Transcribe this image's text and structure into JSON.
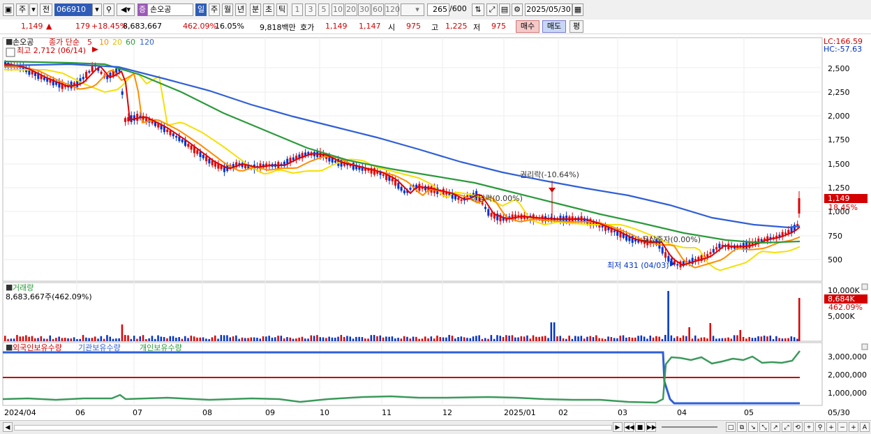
{
  "toolbar": {
    "period": "주",
    "prev": "전",
    "code": "066910",
    "name": "손오공",
    "badge": "증",
    "intervals": [
      "일",
      "주",
      "월",
      "년",
      "분",
      "초",
      "틱"
    ],
    "numbers": [
      "1",
      "3",
      "5",
      "10",
      "20",
      "30",
      "60",
      "120"
    ],
    "count": "265",
    "total": "/600",
    "date": "2025/05/30"
  },
  "info": {
    "price": "1,149",
    "change": "179",
    "change_pct": "+18.45%",
    "volume": "8,683,667",
    "volume_pct": "462.09%",
    "turnover": "16.05%",
    "amount": "9,818백만",
    "quote_label": "호가",
    "ask": "1,149",
    "bid": "1,147",
    "open_label": "시",
    "open": "975",
    "high_label": "고",
    "high": "1,225",
    "low_label": "저",
    "low": "975",
    "buy": "매수",
    "sell": "매도",
    "p": "평"
  },
  "main_legend": {
    "name": "손오공",
    "indicator": "종가 단순",
    "ma5": "5",
    "ma10": "10",
    "ma20": "20",
    "ma60": "60",
    "ma120": "120",
    "lc": "LC:166.59",
    "hc": "HC:-57.63"
  },
  "annotations": {
    "high": "최고 2,712 (06/14)",
    "low": "최저 431 (04/03)",
    "rights": "권리락(-10.64%)",
    "dividend": "배당락(0.00%)",
    "capital": "무상증자(0.00%)"
  },
  "price_axis": [
    "2,500",
    "2,250",
    "2,000",
    "1,750",
    "1,500",
    "1,250",
    "1,000",
    "750",
    "500"
  ],
  "price_tag": {
    "value": "1,149",
    "pct": "18.45%"
  },
  "volume_panel": {
    "title": "거래량",
    "value": "8,683,667주(462.09%)",
    "axis": [
      "10,000K",
      "5,000K"
    ],
    "tag_value": "8,684K",
    "tag_pct": "462.09%"
  },
  "holding_panel": {
    "legend": [
      "외국인보유수량",
      "기관보유수량",
      "개인보유수량"
    ],
    "axis": [
      "3,000,000",
      "2,000,000",
      "1,000,000"
    ]
  },
  "x_axis": [
    "2024/04",
    "06",
    "07",
    "08",
    "09",
    "10",
    "11",
    "12",
    "2025/01",
    "02",
    "03",
    "04",
    "05",
    "05/30"
  ],
  "colors": {
    "ma5": "#e00000",
    "ma10": "#ff8c00",
    "ma20": "#f5e000",
    "ma60": "#2a9a3a",
    "ma120": "#2f5fd8",
    "up": "#e00000",
    "down": "#0033cc"
  }
}
